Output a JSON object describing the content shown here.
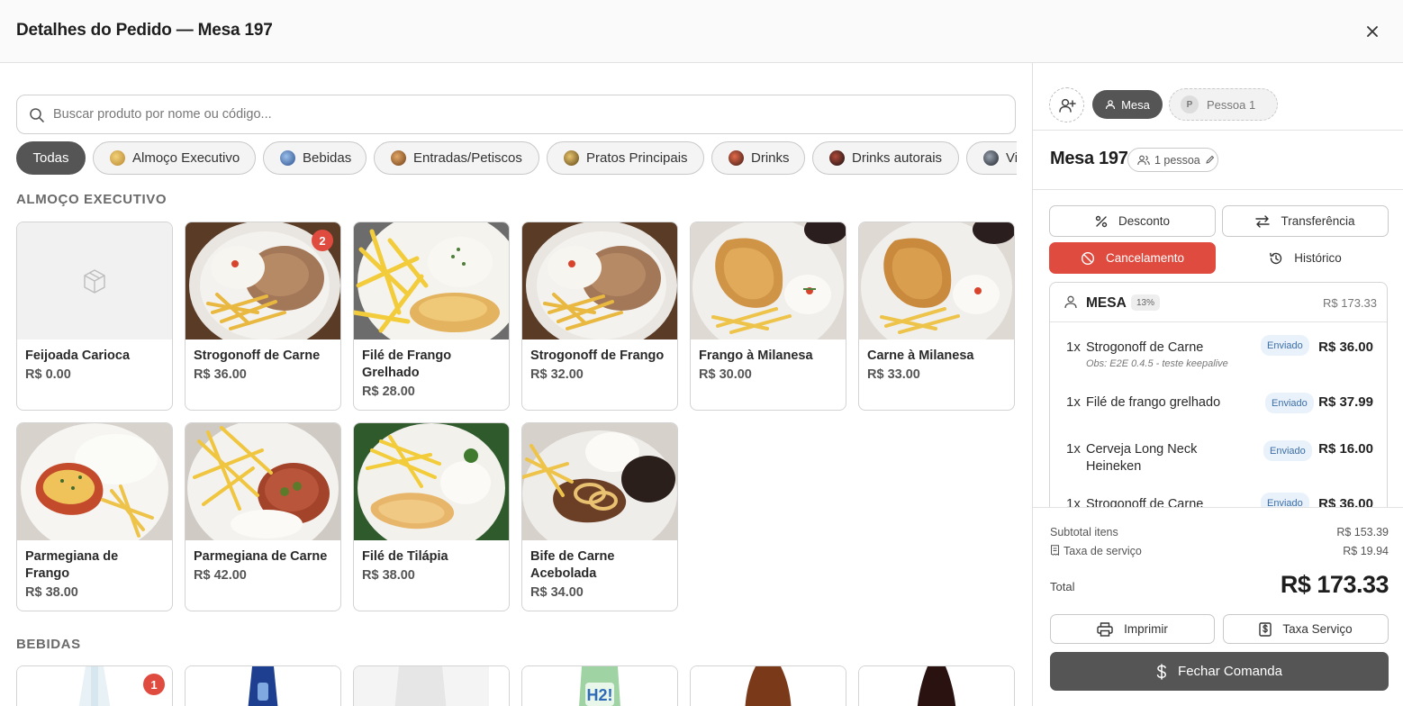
{
  "header": {
    "title": "Detalhes do Pedido — Mesa 197"
  },
  "search": {
    "placeholder": "Buscar produto por nome ou código..."
  },
  "categories": [
    {
      "label": "Todas",
      "active": true
    },
    {
      "label": "Almoço Executivo",
      "color": "#c9a24a"
    },
    {
      "label": "Bebidas",
      "color": "#4a6fb0"
    },
    {
      "label": "Entradas/Petiscos",
      "color": "#a8642c"
    },
    {
      "label": "Pratos Principais",
      "color": "#9a7b2f"
    },
    {
      "label": "Drinks",
      "color": "#7a3a2a"
    },
    {
      "label": "Drinks autorais",
      "color": "#3a2a2a"
    },
    {
      "label": "Vi",
      "color": "#333a44"
    }
  ],
  "sections": [
    {
      "label": "ALMOÇO EXECUTIVO",
      "products": [
        {
          "name": "Feijoada Carioca",
          "price": "R$ 0.00",
          "image": "placeholder"
        },
        {
          "name": "Strogonoff de Carne",
          "price": "R$ 36.00",
          "image": "strogonoff",
          "badge": "2"
        },
        {
          "name": "Filé de Frango Grelhado",
          "price": "R$ 28.00",
          "image": "file-frango"
        },
        {
          "name": "Strogonoff de Frango",
          "price": "R$ 32.00",
          "image": "strogonoff"
        },
        {
          "name": "Frango à Milanesa",
          "price": "R$ 30.00",
          "image": "milanesa"
        },
        {
          "name": "Carne à Milanesa",
          "price": "R$ 33.00",
          "image": "milanesa"
        },
        {
          "name": "Parmegiana de Frango",
          "price": "R$ 38.00",
          "image": "parmegiana-frango"
        },
        {
          "name": "Parmegiana de Carne",
          "price": "R$ 42.00",
          "image": "parmegiana-carne"
        },
        {
          "name": "Filé de Tilápia",
          "price": "R$ 38.00",
          "image": "tilapia"
        },
        {
          "name": "Bife de Carne Acebolada",
          "price": "R$ 34.00",
          "image": "bife"
        }
      ]
    },
    {
      "label": "BEBIDAS",
      "products": [
        {
          "image": "agua",
          "badge": "1"
        },
        {
          "image": "agua-azul"
        },
        {
          "image": "agua-clara"
        },
        {
          "image": "h2o"
        },
        {
          "image": "cerveja"
        },
        {
          "image": "refrigerante"
        }
      ]
    }
  ],
  "bebida_label": "H2!",
  "people": {
    "mesa_label": "Mesa",
    "person_initial": "P",
    "person_label": "Pessoa 1"
  },
  "table": {
    "title": "Mesa 197",
    "people_count": "1 pessoa"
  },
  "actions": {
    "desconto": "Desconto",
    "transferencia": "Transferência",
    "cancelamento": "Cancelamento",
    "historico": "Histórico"
  },
  "order": {
    "group_label": "MESA",
    "service_pct": "13%",
    "group_total": "R$ 173.33",
    "items": [
      {
        "qty": "1x",
        "name": "Strogonoff de Carne",
        "obs": "Obs: E2E 0.4.5 - teste keepalive",
        "status": "Enviado",
        "price": "R$ 36.00"
      },
      {
        "qty": "1x",
        "name": "Filé de frango grelhado",
        "status": "Enviado",
        "price": "R$ 37.99"
      },
      {
        "qty": "1x",
        "name": "Cerveja Long Neck Heineken",
        "status": "Enviado",
        "price": "R$ 16.00"
      },
      {
        "qty": "1x",
        "name": "Strogonoff de Carne",
        "status": "Enviado",
        "price": "R$ 36.00"
      }
    ]
  },
  "summary": {
    "subtotal_label": "Subtotal itens",
    "subtotal_value": "R$ 153.39",
    "service_label": "Taxa de serviço",
    "service_value": "R$ 19.94",
    "total_label": "Total",
    "total_value": "R$ 173.33"
  },
  "footer_actions": {
    "imprimir": "Imprimir",
    "taxa_servico": "Taxa Serviço",
    "fechar": "Fechar Comanda"
  },
  "colors": {
    "accent_dark": "#555555",
    "danger": "#e04b3f",
    "badge": "#e04b3f",
    "status_bg": "#e9f2fb",
    "status_text": "#3d6fa8"
  }
}
